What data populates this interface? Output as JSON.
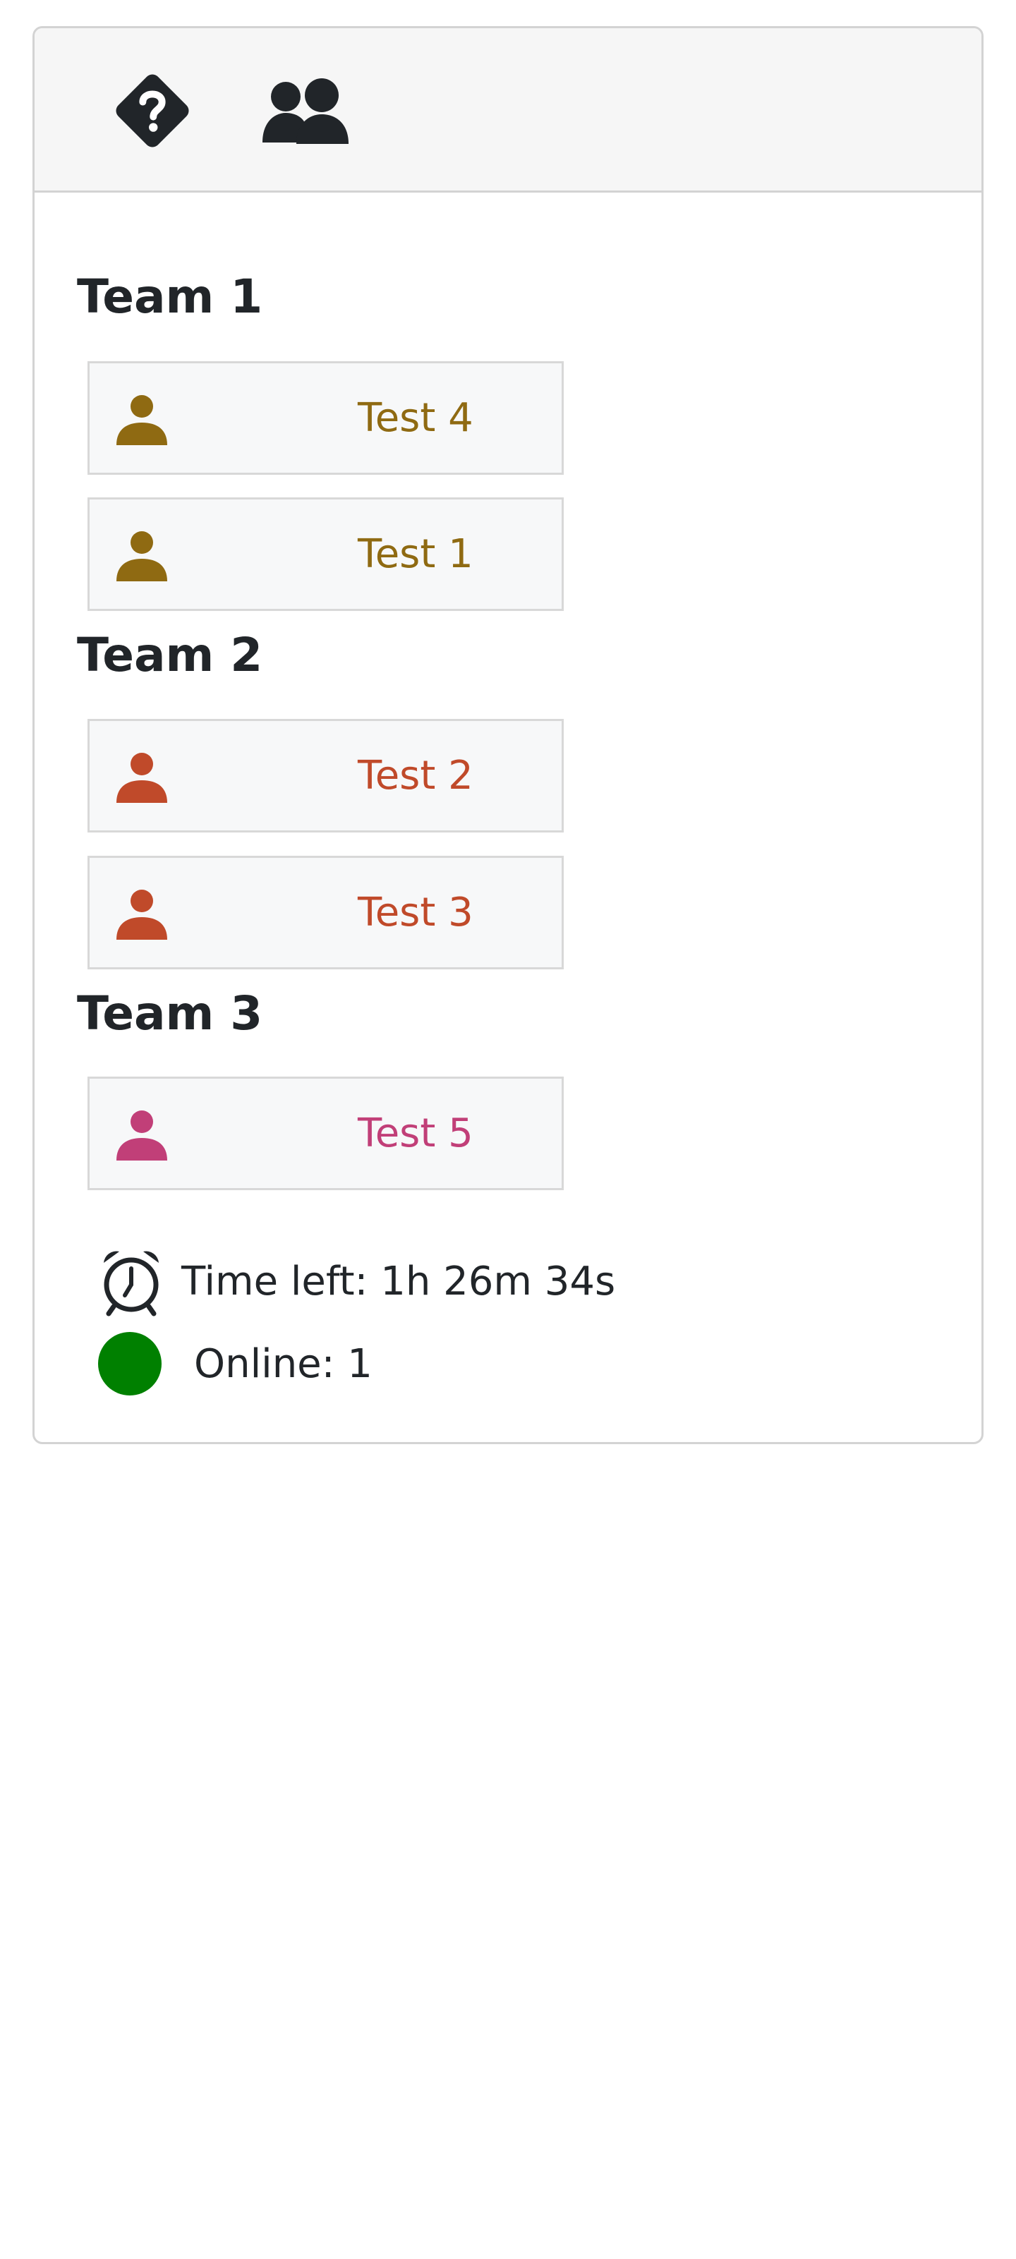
{
  "header": {
    "icons": [
      {
        "name": "help-diamond-icon"
      },
      {
        "name": "users-icon"
      }
    ]
  },
  "teams": [
    {
      "title": "Team 1",
      "color": "#8f6a12",
      "players": [
        {
          "name": "Test 4",
          "icon": "user-icon"
        },
        {
          "name": "Test 1",
          "icon": "user-icon"
        }
      ]
    },
    {
      "title": "Team 2",
      "color": "#c04a2a",
      "players": [
        {
          "name": "Test 2",
          "icon": "user-icon"
        },
        {
          "name": "Test 3",
          "icon": "user-icon"
        }
      ]
    },
    {
      "title": "Team 3",
      "color": "#c13f78",
      "players": [
        {
          "name": "Test 5",
          "icon": "user-icon"
        }
      ]
    }
  ],
  "status": {
    "time_left": "Time left: 1h 26m 34s",
    "time_icon": "alarm-clock-icon",
    "online": "Online: 1",
    "online_color": "#008000"
  }
}
